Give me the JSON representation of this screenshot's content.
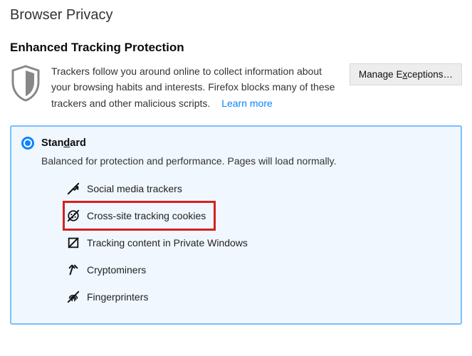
{
  "page": {
    "title": "Browser Privacy"
  },
  "etp": {
    "heading": "Enhanced Tracking Protection",
    "description": "Trackers follow you around online to collect information about your browsing habits and interests. Firefox blocks many of these trackers and other malicious scripts.",
    "learn_more": "Learn more",
    "manage_exceptions_pre": "Manage E",
    "manage_exceptions_ul": "x",
    "manage_exceptions_post": "ceptions…"
  },
  "option": {
    "name_pre": "Stan",
    "name_ul": "d",
    "name_post": "ard",
    "desc": "Balanced for protection and performance. Pages will load normally.",
    "items": [
      {
        "label": "Social media trackers",
        "icon": "social"
      },
      {
        "label": "Cross-site tracking cookies",
        "icon": "cookie",
        "highlight": true
      },
      {
        "label": "Tracking content in Private Windows",
        "icon": "tracking-content"
      },
      {
        "label": "Cryptominers",
        "icon": "cryptominer"
      },
      {
        "label": "Fingerprinters",
        "icon": "fingerprint"
      }
    ]
  }
}
